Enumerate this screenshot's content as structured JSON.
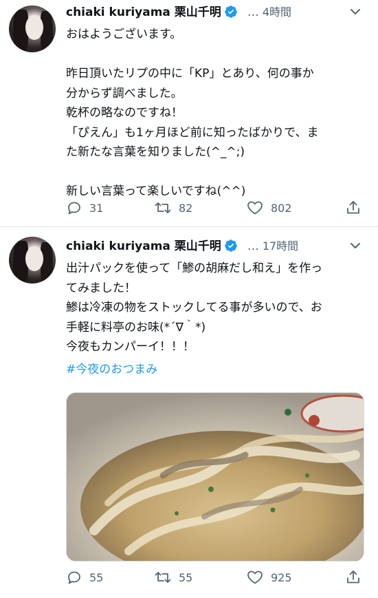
{
  "tweets": [
    {
      "display_name": "chiaki kuriyama 栗山千明",
      "dots": "…",
      "time": "4時間",
      "text": "おはようございます。\n\n昨日頂いたリプの中に「KP」とあり、何の事か\n分からず調べました。\n乾杯の略なのですね！\n「ぴえん」も1ヶ月ほど前に知ったばかりで、ま\nた新たな言葉を知りました(^_^;)\n\n新しい言葉って楽しいですね(^^)",
      "replies": "31",
      "retweets": "82",
      "likes": "802"
    },
    {
      "display_name": "chiaki kuriyama 栗山千明",
      "dots": "…",
      "time": "17時間",
      "text": "出汁パックを使って「鯵の胡麻だし和え」を作っ\nてみました！\n鯵は冷凍の物をストックしてる事が多いので、お\n手軽に料亭のお味(*´∇｀*)\n今夜もカンパーイ！！！",
      "hashtag": "#今夜のおつまみ",
      "replies": "55",
      "retweets": "55",
      "likes": "925"
    }
  ],
  "icons": {
    "verified": "verified-badge-icon",
    "caret": "chevron-down-icon",
    "reply": "reply-icon",
    "retweet": "retweet-icon",
    "like": "heart-icon",
    "share": "share-icon"
  },
  "colors": {
    "verified": "#1d9bf0",
    "hashtag": "#1d9bf0",
    "muted": "#536471"
  }
}
